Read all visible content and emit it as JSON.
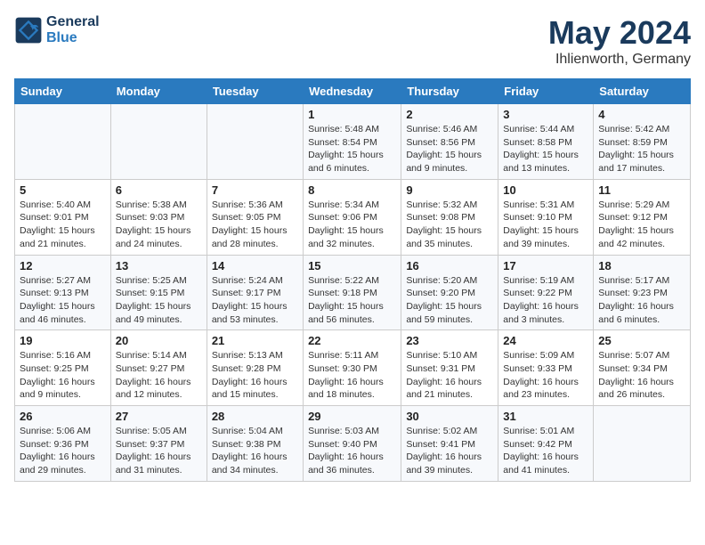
{
  "header": {
    "logo_line1": "General",
    "logo_line2": "Blue",
    "month_title": "May 2024",
    "location": "Ihlienworth, Germany"
  },
  "weekdays": [
    "Sunday",
    "Monday",
    "Tuesday",
    "Wednesday",
    "Thursday",
    "Friday",
    "Saturday"
  ],
  "weeks": [
    [
      {
        "day": "",
        "text": ""
      },
      {
        "day": "",
        "text": ""
      },
      {
        "day": "",
        "text": ""
      },
      {
        "day": "1",
        "text": "Sunrise: 5:48 AM\nSunset: 8:54 PM\nDaylight: 15 hours and 6 minutes."
      },
      {
        "day": "2",
        "text": "Sunrise: 5:46 AM\nSunset: 8:56 PM\nDaylight: 15 hours and 9 minutes."
      },
      {
        "day": "3",
        "text": "Sunrise: 5:44 AM\nSunset: 8:58 PM\nDaylight: 15 hours and 13 minutes."
      },
      {
        "day": "4",
        "text": "Sunrise: 5:42 AM\nSunset: 8:59 PM\nDaylight: 15 hours and 17 minutes."
      }
    ],
    [
      {
        "day": "5",
        "text": "Sunrise: 5:40 AM\nSunset: 9:01 PM\nDaylight: 15 hours and 21 minutes."
      },
      {
        "day": "6",
        "text": "Sunrise: 5:38 AM\nSunset: 9:03 PM\nDaylight: 15 hours and 24 minutes."
      },
      {
        "day": "7",
        "text": "Sunrise: 5:36 AM\nSunset: 9:05 PM\nDaylight: 15 hours and 28 minutes."
      },
      {
        "day": "8",
        "text": "Sunrise: 5:34 AM\nSunset: 9:06 PM\nDaylight: 15 hours and 32 minutes."
      },
      {
        "day": "9",
        "text": "Sunrise: 5:32 AM\nSunset: 9:08 PM\nDaylight: 15 hours and 35 minutes."
      },
      {
        "day": "10",
        "text": "Sunrise: 5:31 AM\nSunset: 9:10 PM\nDaylight: 15 hours and 39 minutes."
      },
      {
        "day": "11",
        "text": "Sunrise: 5:29 AM\nSunset: 9:12 PM\nDaylight: 15 hours and 42 minutes."
      }
    ],
    [
      {
        "day": "12",
        "text": "Sunrise: 5:27 AM\nSunset: 9:13 PM\nDaylight: 15 hours and 46 minutes."
      },
      {
        "day": "13",
        "text": "Sunrise: 5:25 AM\nSunset: 9:15 PM\nDaylight: 15 hours and 49 minutes."
      },
      {
        "day": "14",
        "text": "Sunrise: 5:24 AM\nSunset: 9:17 PM\nDaylight: 15 hours and 53 minutes."
      },
      {
        "day": "15",
        "text": "Sunrise: 5:22 AM\nSunset: 9:18 PM\nDaylight: 15 hours and 56 minutes."
      },
      {
        "day": "16",
        "text": "Sunrise: 5:20 AM\nSunset: 9:20 PM\nDaylight: 15 hours and 59 minutes."
      },
      {
        "day": "17",
        "text": "Sunrise: 5:19 AM\nSunset: 9:22 PM\nDaylight: 16 hours and 3 minutes."
      },
      {
        "day": "18",
        "text": "Sunrise: 5:17 AM\nSunset: 9:23 PM\nDaylight: 16 hours and 6 minutes."
      }
    ],
    [
      {
        "day": "19",
        "text": "Sunrise: 5:16 AM\nSunset: 9:25 PM\nDaylight: 16 hours and 9 minutes."
      },
      {
        "day": "20",
        "text": "Sunrise: 5:14 AM\nSunset: 9:27 PM\nDaylight: 16 hours and 12 minutes."
      },
      {
        "day": "21",
        "text": "Sunrise: 5:13 AM\nSunset: 9:28 PM\nDaylight: 16 hours and 15 minutes."
      },
      {
        "day": "22",
        "text": "Sunrise: 5:11 AM\nSunset: 9:30 PM\nDaylight: 16 hours and 18 minutes."
      },
      {
        "day": "23",
        "text": "Sunrise: 5:10 AM\nSunset: 9:31 PM\nDaylight: 16 hours and 21 minutes."
      },
      {
        "day": "24",
        "text": "Sunrise: 5:09 AM\nSunset: 9:33 PM\nDaylight: 16 hours and 23 minutes."
      },
      {
        "day": "25",
        "text": "Sunrise: 5:07 AM\nSunset: 9:34 PM\nDaylight: 16 hours and 26 minutes."
      }
    ],
    [
      {
        "day": "26",
        "text": "Sunrise: 5:06 AM\nSunset: 9:36 PM\nDaylight: 16 hours and 29 minutes."
      },
      {
        "day": "27",
        "text": "Sunrise: 5:05 AM\nSunset: 9:37 PM\nDaylight: 16 hours and 31 minutes."
      },
      {
        "day": "28",
        "text": "Sunrise: 5:04 AM\nSunset: 9:38 PM\nDaylight: 16 hours and 34 minutes."
      },
      {
        "day": "29",
        "text": "Sunrise: 5:03 AM\nSunset: 9:40 PM\nDaylight: 16 hours and 36 minutes."
      },
      {
        "day": "30",
        "text": "Sunrise: 5:02 AM\nSunset: 9:41 PM\nDaylight: 16 hours and 39 minutes."
      },
      {
        "day": "31",
        "text": "Sunrise: 5:01 AM\nSunset: 9:42 PM\nDaylight: 16 hours and 41 minutes."
      },
      {
        "day": "",
        "text": ""
      }
    ]
  ]
}
